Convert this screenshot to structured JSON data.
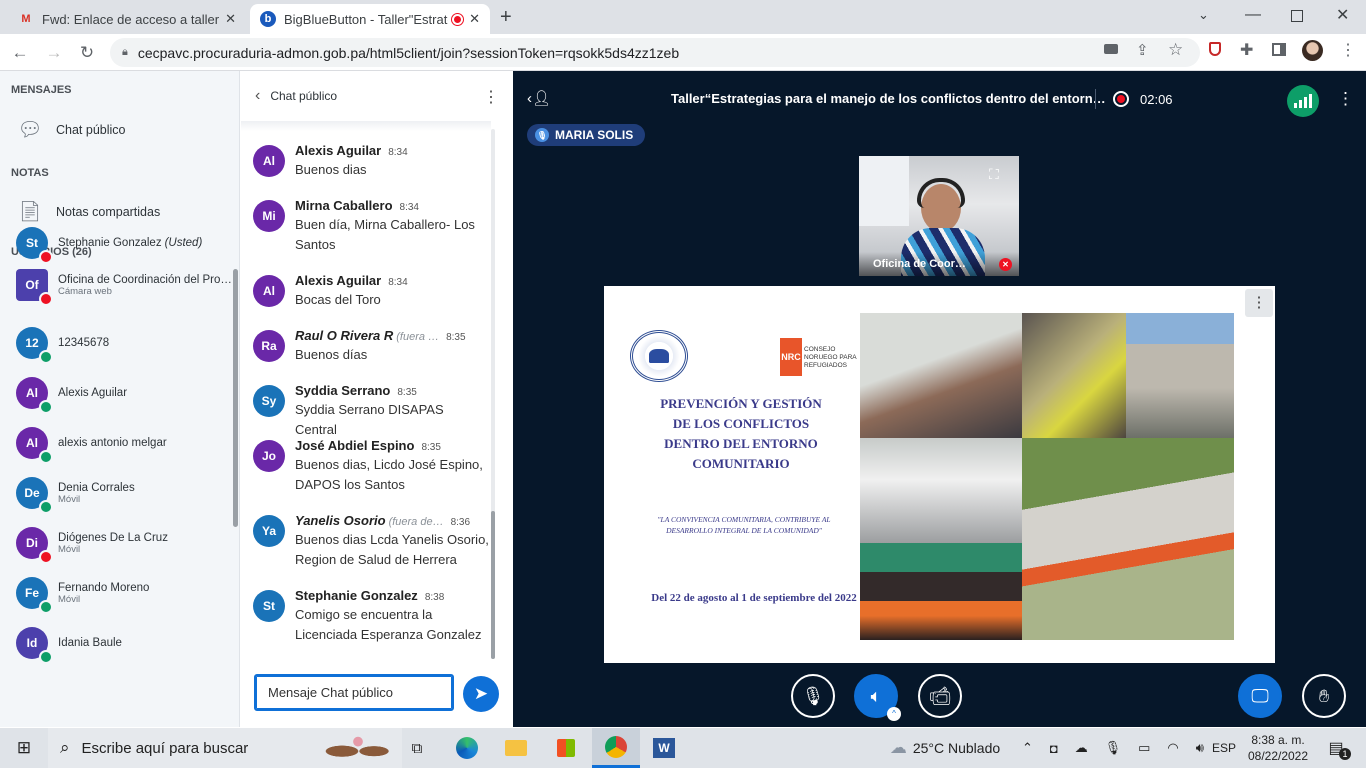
{
  "browser": {
    "tabs": [
      {
        "title": "Fwd: Enlace de acceso a taller - ta",
        "active": false
      },
      {
        "title": "BigBlueButton - Taller\"Estrate",
        "active": true
      }
    ],
    "new_tab": "+",
    "url": "cecpavc.procuraduria-admon.gob.pa/html5client/join?sessionToken=rqsokk5ds4zz1zeb"
  },
  "left_panel": {
    "messages_header": "MENSAJES",
    "public_chat": "Chat público",
    "notes_header": "NOTAS",
    "shared_notes": "Notas compartidas",
    "users_header": "USUARIOS (26)",
    "users": [
      {
        "initials": "St",
        "name": "Stephanie Gonzalez",
        "suffix": "(Usted)",
        "sub": "",
        "color": "#1a73b8",
        "status": "muted"
      },
      {
        "initials": "Of",
        "name": "Oficina de Coordinación del Progr…",
        "suffix": "",
        "sub": "Cámara web",
        "color": "#4c40ac",
        "status": "muted"
      },
      {
        "initials": "12",
        "name": "12345678",
        "suffix": "",
        "sub": "",
        "color": "#1a73b8",
        "status": "listen"
      },
      {
        "initials": "Al",
        "name": "Alexis Aguilar",
        "suffix": "",
        "sub": "",
        "color": "#6a28a8",
        "status": "listen"
      },
      {
        "initials": "Al",
        "name": "alexis antonio melgar",
        "suffix": "",
        "sub": "",
        "color": "#6a28a8",
        "status": "listen"
      },
      {
        "initials": "De",
        "name": "Denia Corrales",
        "suffix": "",
        "sub": "Móvil",
        "color": "#1a73b8",
        "status": "listen"
      },
      {
        "initials": "Di",
        "name": "Diógenes De La Cruz",
        "suffix": "",
        "sub": "Móvil",
        "color": "#6a28a8",
        "status": "muted"
      },
      {
        "initials": "Fe",
        "name": "Fernando Moreno",
        "suffix": "",
        "sub": "Móvil",
        "color": "#1a73b8",
        "status": "listen"
      },
      {
        "initials": "Id",
        "name": "Idania Baule",
        "suffix": "",
        "sub": "",
        "color": "#4c40ac",
        "status": "listen"
      }
    ]
  },
  "chat": {
    "title": "Chat público",
    "messages": [
      {
        "initials": "Al",
        "name": "Alexis Aguilar",
        "away": "",
        "time": "8:34",
        "text": "Buenos dias",
        "color": "#6a28a8",
        "italic": false
      },
      {
        "initials": "Mi",
        "name": "Mirna Caballero",
        "away": "",
        "time": "8:34",
        "text": "Buen día, Mirna Caballero- Los Santos",
        "color": "#6a28a8",
        "italic": false
      },
      {
        "initials": "Al",
        "name": "Alexis Aguilar",
        "away": "",
        "time": "8:34",
        "text": "Bocas del Toro",
        "color": "#6a28a8",
        "italic": false
      },
      {
        "initials": "Ra",
        "name": "Raul O Rivera R",
        "away": "(fuera …",
        "time": "8:35",
        "text": "Buenos días",
        "color": "#6a28a8",
        "italic": true
      },
      {
        "initials": "Sy",
        "name": "Syddia Serrano",
        "away": "",
        "time": "8:35",
        "text": "Syddia Serrano DISAPAS Central",
        "color": "#1a73b8",
        "italic": false
      },
      {
        "initials": "Jo",
        "name": "José Abdiel Espino",
        "away": "",
        "time": "8:35",
        "text": "Buenos dias, Licdo José Espino, DAPOS los Santos",
        "color": "#6a28a8",
        "italic": false
      },
      {
        "initials": "Ya",
        "name": "Yanelis Osorio",
        "away": "(fuera de…",
        "time": "8:36",
        "text": "Buenos dias Lcda Yanelis Osorio, Region de Salud de Herrera",
        "color": "#1a73b8",
        "italic": true
      },
      {
        "initials": "St",
        "name": "Stephanie Gonzalez",
        "away": "",
        "time": "8:38",
        "text": "Comigo se encuentra la Licenciada Esperanza Gonzalez",
        "color": "#1a73b8",
        "italic": false
      }
    ],
    "input_placeholder": "Mensaje Chat público"
  },
  "main": {
    "title": "Taller“Estrategias para el manejo de los conflictos dentro del entorn…",
    "record_time": "02:06",
    "talker": "MARIA SOLIS",
    "webcam_label": "Oficina de Coor…",
    "slide": {
      "org_label": "NRC",
      "org_name": "CONSEJO NORUEGO PARA REFUGIADOS",
      "heading_lines": [
        "PREVENCIÓN Y GESTIÓN",
        "DE LOS CONFLICTOS",
        "DENTRO DEL ENTORNO",
        "COMUNITARIO"
      ],
      "quote": "\"LA CONVIVENCIA COMUNITARIA, CONTRIBUYE AL DESARROLLO INTEGRAL DE LA COMUNIDAD\"",
      "dates": "Del 22 de agosto al 1 de septiembre del 2022"
    }
  },
  "taskbar": {
    "search_placeholder": "Escribe aquí para buscar",
    "weather": "25°C  Nublado",
    "lang": "ESP",
    "time": "8:38 a. m.",
    "date": "08/22/2022",
    "notif_count": "1"
  },
  "colors": {
    "accent": "#0f70d7",
    "main_bg": "#06172a"
  }
}
